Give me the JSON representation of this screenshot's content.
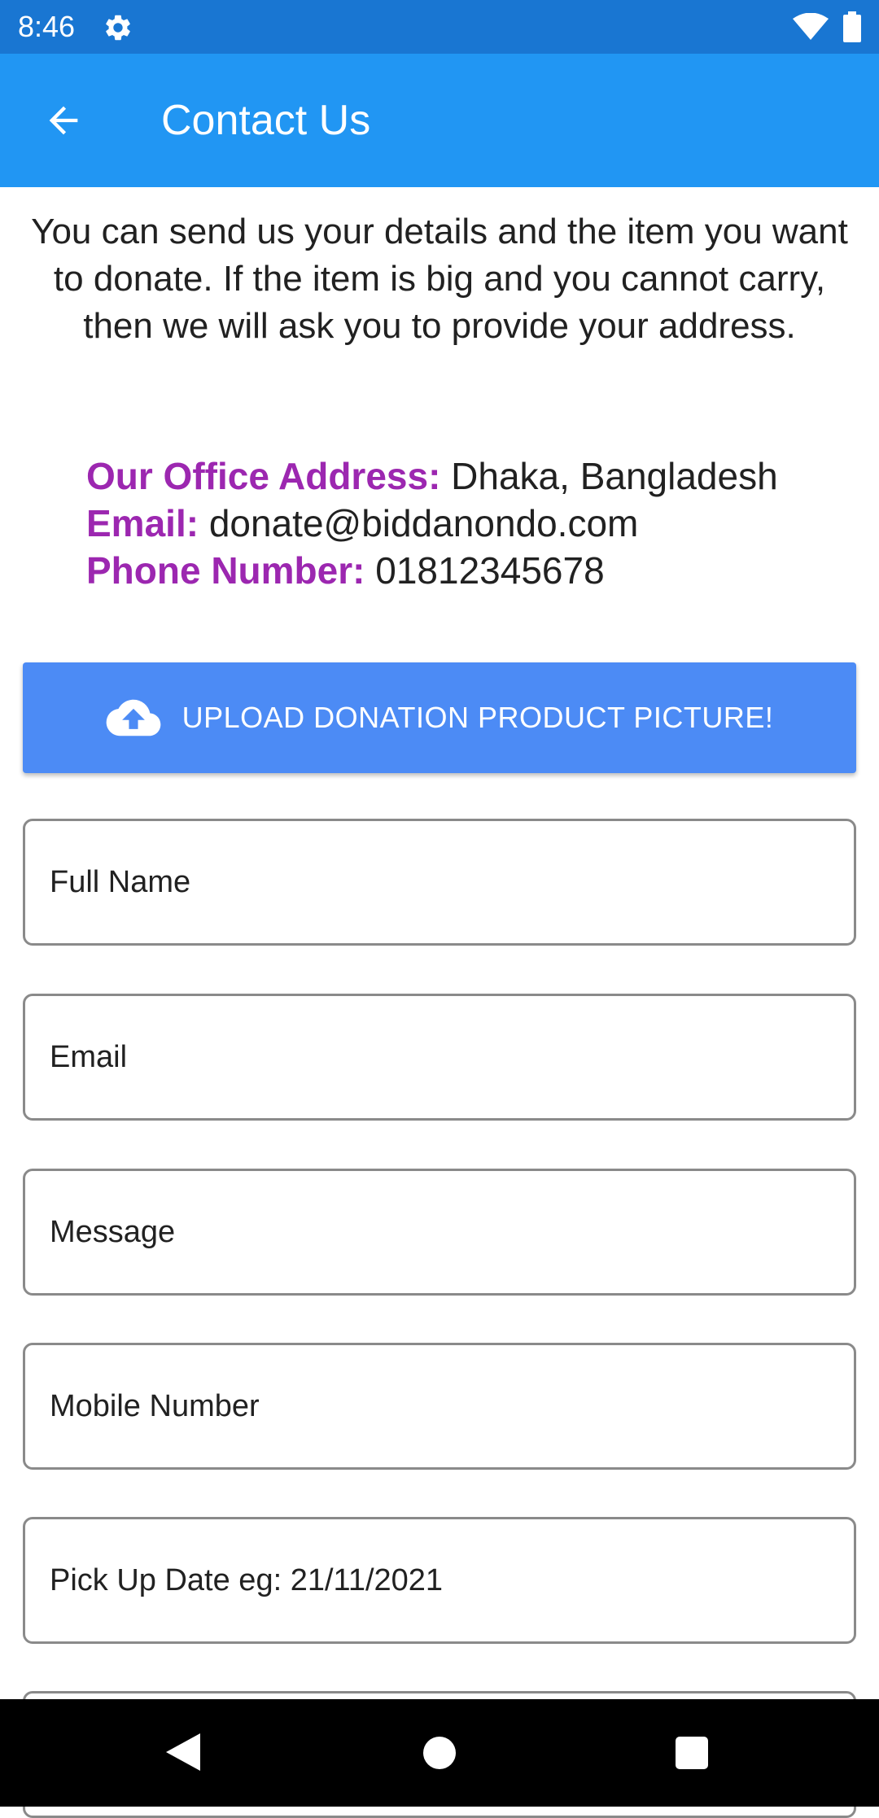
{
  "status_bar": {
    "time": "8:46",
    "icons": [
      "gear-icon",
      "wifi-icon",
      "battery-icon"
    ]
  },
  "app_bar": {
    "title": "Contact Us",
    "back_icon": "arrow-back-icon",
    "color": "#2196f3"
  },
  "intro": {
    "text": "You can send us your details and the item you want to donate. If the item is big and you cannot carry, then we will ask you to provide your address."
  },
  "contact": {
    "address_label": "Our Office Address:",
    "address_value": "Dhaka, Bangladesh",
    "email_label": "Email:",
    "email_value": "donate@biddanondo.com",
    "phone_label": "Phone Number:",
    "phone_value": "01812345678",
    "label_color": "#9c27b0"
  },
  "upload": {
    "label": "UPLOAD DONATION PRODUCT PICTURE!",
    "icon": "cloud-upload-icon",
    "color": "#4c8bf5"
  },
  "form": {
    "full_name": {
      "placeholder": "Full Name",
      "value": ""
    },
    "email": {
      "placeholder": "Email",
      "value": ""
    },
    "message": {
      "placeholder": "Message",
      "value": ""
    },
    "mobile": {
      "placeholder": "Mobile Number",
      "value": ""
    },
    "pickup_date": {
      "placeholder": "Pick Up Date eg: 21/11/2021",
      "value": ""
    }
  },
  "nav_bar": {
    "buttons": [
      "back-triangle-icon",
      "home-circle-icon",
      "recents-square-icon"
    ]
  }
}
